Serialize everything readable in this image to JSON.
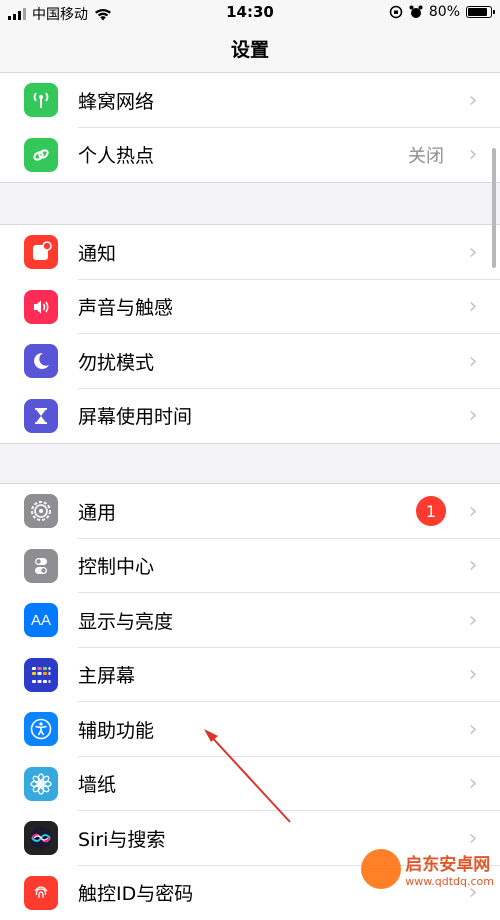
{
  "status_bar": {
    "carrier": "中国移动",
    "time": "14:30",
    "battery_pct": "80%"
  },
  "nav": {
    "title": "设置"
  },
  "groups": [
    {
      "items": [
        {
          "label": "蜂窝网络",
          "icon": "cellular-antenna-icon",
          "color": "#34c759"
        },
        {
          "label": "个人热点",
          "icon": "hotspot-chain-icon",
          "color": "#34c759",
          "value": "关闭"
        }
      ]
    },
    {
      "items": [
        {
          "label": "通知",
          "icon": "notification-icon",
          "color": "#ff3b30"
        },
        {
          "label": "声音与触感",
          "icon": "speaker-icon",
          "color": "#ff2d55"
        },
        {
          "label": "勿扰模式",
          "icon": "moon-icon",
          "color": "#5856d6"
        },
        {
          "label": "屏幕使用时间",
          "icon": "hourglass-icon",
          "color": "#5856d6"
        }
      ]
    },
    {
      "items": [
        {
          "label": "通用",
          "icon": "gear-icon",
          "color": "#8e8e93",
          "badge": "1"
        },
        {
          "label": "控制中心",
          "icon": "toggles-icon",
          "color": "#8e8e93"
        },
        {
          "label": "显示与亮度",
          "icon": "text-size-icon",
          "color": "#007aff"
        },
        {
          "label": "主屏幕",
          "icon": "home-grid-icon",
          "color": "#2c3cc9"
        },
        {
          "label": "辅助功能",
          "icon": "accessibility-icon",
          "color": "#0a84ff"
        },
        {
          "label": "墙纸",
          "icon": "wallpaper-flower-icon",
          "color": "#36aadc"
        },
        {
          "label": "Siri与搜索",
          "icon": "siri-icon",
          "color": "#222"
        },
        {
          "label": "触控ID与密码",
          "icon": "fingerprint-icon",
          "color": "#ff3b30"
        }
      ]
    }
  ],
  "watermark": {
    "title": "启东安卓网",
    "sub": "www.qdtdq.com"
  }
}
